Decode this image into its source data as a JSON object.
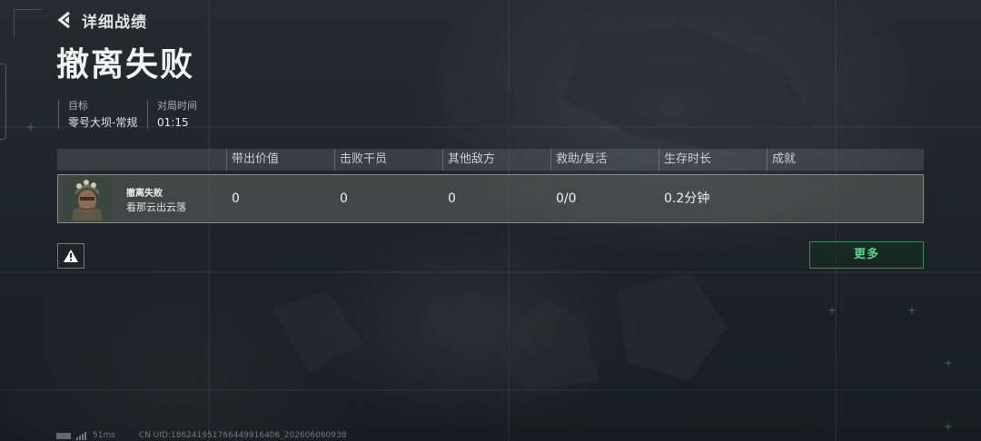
{
  "header": {
    "back_label": "详细战绩",
    "title": "撤离失败"
  },
  "match_info": {
    "target_label": "目标",
    "target_value": "零号大坝-常规",
    "time_label": "对局时间",
    "time_value": "01:15"
  },
  "table": {
    "columns": [
      "带出价值",
      "击败干员",
      "其他敌方",
      "救助/复活",
      "生存时长",
      "成就"
    ],
    "row": {
      "status": "撤离失败",
      "player_name": "看那云出云落",
      "values": [
        "0",
        "0",
        "0",
        "0/0",
        "0.2分钟",
        ""
      ]
    }
  },
  "buttons": {
    "more_label": "更多"
  },
  "status_bar": {
    "ping": "51ms",
    "uid": "CN UID:1862419517664499164​06_202606060938"
  },
  "colors": {
    "accent_green": "#58d68a",
    "row_bg": "#5f645f"
  },
  "icons": {
    "back": "chevron-left-icon",
    "warning": "warning-triangle-icon",
    "battery": "battery-icon",
    "signal": "signal-icon"
  }
}
